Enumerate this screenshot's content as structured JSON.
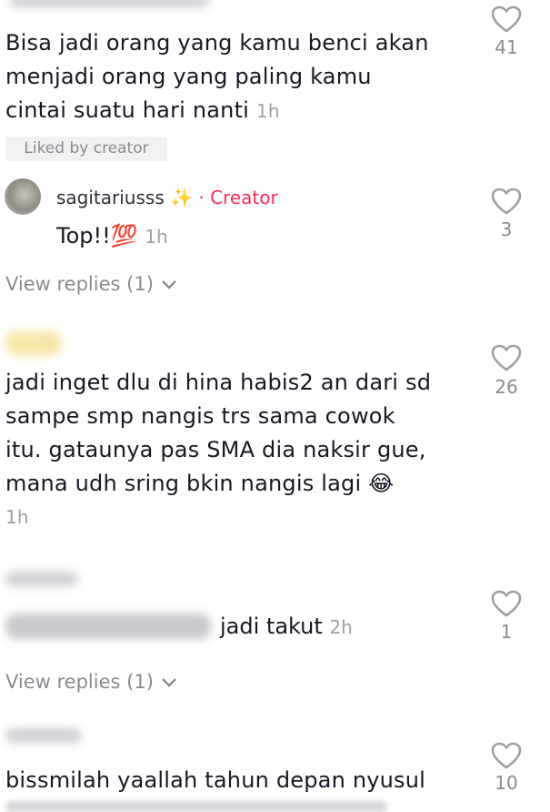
{
  "comments": [
    {
      "text": "Bisa jadi orang yang kamu benci akan menjadi orang yang paling kamu cintai suatu hari nanti",
      "line1": "Bisa jadi orang yang kamu benci akan",
      "line2": "menjadi orang yang paling kamu",
      "line3": "cintai suatu hari nanti",
      "time": "1h",
      "likes": "41",
      "liked_by_creator": "Liked by creator"
    },
    {
      "username": "sagitariusss",
      "username_emoji": "✨",
      "creator_label": "· Creator",
      "text": "Top!!💯",
      "time": "1h",
      "likes": "3",
      "view_replies": "View replies (1)"
    },
    {
      "line1": "jadi inget dlu di hina habis2 an dari sd",
      "line2": "sampe smp nangis trs sama cowok",
      "line3": "itu. gataunya pas SMA dia naksir gue,",
      "line4": "mana udh sring bkin nangis lagi 😂",
      "time": "1h",
      "likes": "26"
    },
    {
      "text": "jadi takut",
      "time": "2h",
      "likes": "1",
      "view_replies": "View replies (1)"
    },
    {
      "line1": "bissmilah yaallah tahun depan nyusul",
      "likes": "10"
    }
  ]
}
